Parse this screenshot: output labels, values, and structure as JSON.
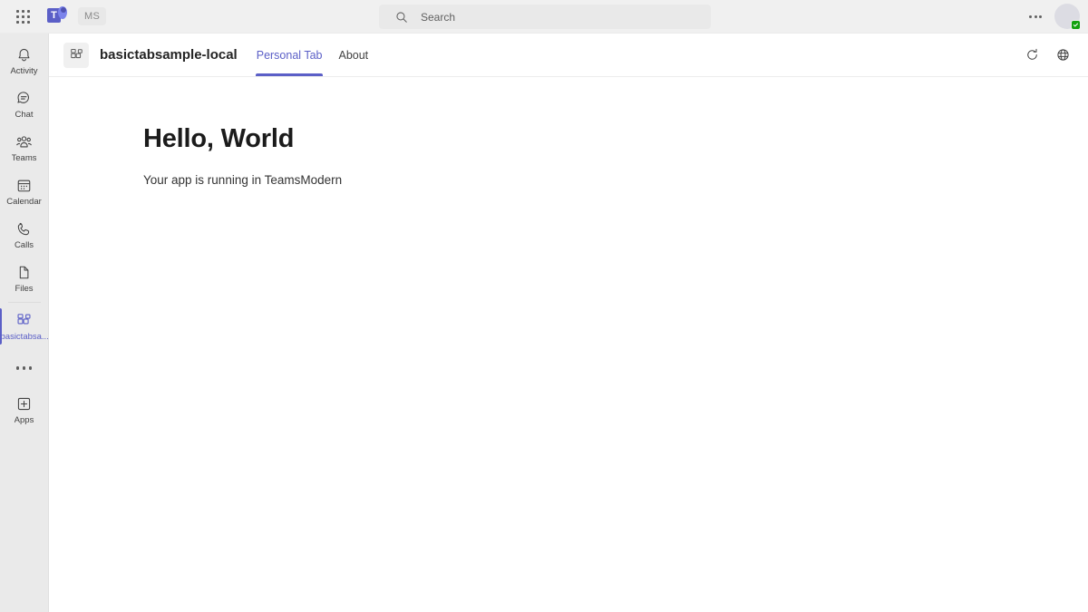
{
  "topbar": {
    "app_launcher_icon": "waffle-grid-icon",
    "teams_logo_letter": "T",
    "tenant_badge": "MS",
    "search": {
      "placeholder": "Search",
      "value": "",
      "icon": "search-icon"
    },
    "more_label": "…",
    "avatar": {
      "initials": "",
      "presence": "Available",
      "presence_color": "#13a10e"
    }
  },
  "rail": {
    "items": [
      {
        "label": "Activity",
        "icon": "bell-icon",
        "selected": false
      },
      {
        "label": "Chat",
        "icon": "chat-bubble-icon",
        "selected": false
      },
      {
        "label": "Teams",
        "icon": "people-icon",
        "selected": false
      },
      {
        "label": "Calendar",
        "icon": "calendar-icon",
        "selected": false
      },
      {
        "label": "Calls",
        "icon": "phone-icon",
        "selected": false
      },
      {
        "label": "Files",
        "icon": "file-icon",
        "selected": false
      },
      {
        "label": "basictabsa...",
        "icon": "tab-app-icon",
        "selected": true
      }
    ],
    "more_apps_label": "…",
    "apps": {
      "label": "Apps",
      "icon": "plus-square-icon"
    }
  },
  "app_header": {
    "icon": "tab-app-icon",
    "title": "basictabsample-local",
    "tabs": [
      {
        "label": "Personal Tab",
        "active": true
      },
      {
        "label": "About",
        "active": false
      }
    ],
    "actions": [
      {
        "name": "refresh-icon",
        "label": "Refresh"
      },
      {
        "name": "globe-icon",
        "label": "Open in browser"
      }
    ]
  },
  "main": {
    "heading": "Hello, World",
    "subtext": "Your app is running in TeamsModern"
  },
  "colors": {
    "accent": "#5b5fc7",
    "rail_bg": "#eaeaea",
    "topbar_bg": "#f0f0f0",
    "content_bg": "#ffffff",
    "presence_green": "#13a10e"
  }
}
